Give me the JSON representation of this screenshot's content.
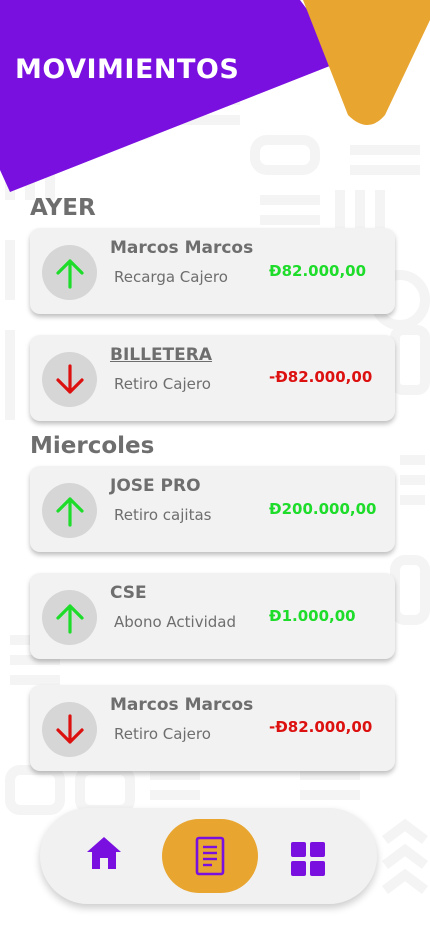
{
  "page": {
    "title": "MOVIMIENTOS"
  },
  "colors": {
    "header_purple": "#7a10e0",
    "accent_orange": "#e8a530",
    "positive": "#1ddc2a",
    "negative": "#dd1010",
    "card_bg": "#f2f2f2"
  },
  "sections": [
    {
      "title": "AYER",
      "items": [
        {
          "name": "Marcos Marcos",
          "description": "Recarga Cajero",
          "amount": "Đ82.000,00",
          "direction": "up",
          "name_underlined": false
        },
        {
          "name": "BILLETERA",
          "description": "Retiro Cajero",
          "amount": "-Đ82.000,00",
          "direction": "down",
          "name_underlined": true
        }
      ]
    },
    {
      "title": "Miercoles",
      "items": [
        {
          "name": "JOSE PRO",
          "description": "Retiro cajitas",
          "amount": "Đ200.000,00",
          "direction": "up",
          "name_underlined": false
        },
        {
          "name": "CSE",
          "description": "Abono Actividad",
          "amount": "Đ1.000,00",
          "direction": "up",
          "name_underlined": false
        },
        {
          "name": "Marcos Marcos",
          "description": "Retiro Cajero",
          "amount": "-Đ82.000,00",
          "direction": "down",
          "name_underlined": false
        }
      ]
    }
  ],
  "bottom_nav": [
    {
      "icon": "home-icon",
      "active": false
    },
    {
      "icon": "document-icon",
      "active": true
    },
    {
      "icon": "grid-icon",
      "active": false
    }
  ]
}
